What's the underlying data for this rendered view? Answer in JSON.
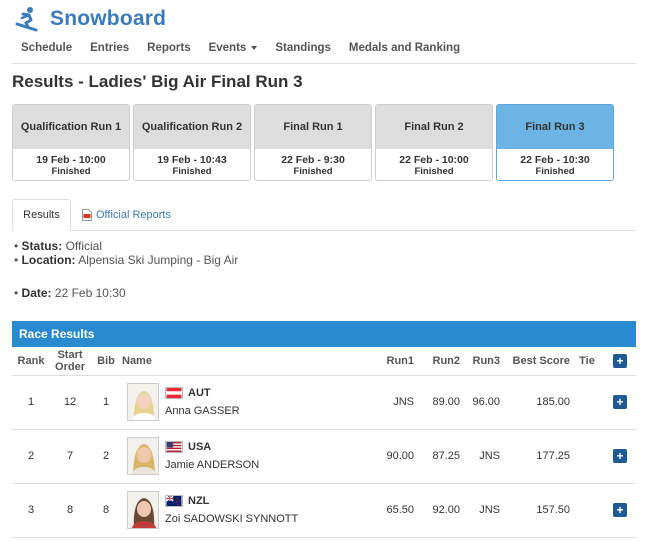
{
  "app": {
    "title": "Snowboard",
    "logo_icon": "snowboarder-icon"
  },
  "nav": [
    {
      "label": "Schedule"
    },
    {
      "label": "Entries"
    },
    {
      "label": "Reports"
    },
    {
      "label": "Events",
      "dropdown": true
    },
    {
      "label": "Standings"
    },
    {
      "label": "Medals and Ranking"
    }
  ],
  "page_title": "Results - Ladies' Big Air Final Run 3",
  "runs": [
    {
      "name": "Qualification Run 1",
      "date": "19 Feb - 10:00",
      "status": "Finished",
      "active": false
    },
    {
      "name": "Qualification Run 2",
      "date": "19 Feb - 10:43",
      "status": "Finished",
      "active": false
    },
    {
      "name": "Final Run 1",
      "date": "22 Feb - 9:30",
      "status": "Finished",
      "active": false
    },
    {
      "name": "Final Run 2",
      "date": "22 Feb - 10:00",
      "status": "Finished",
      "active": false
    },
    {
      "name": "Final Run 3",
      "date": "22 Feb - 10:30",
      "status": "Finished",
      "active": true
    }
  ],
  "tabs": {
    "results": "Results",
    "official_reports": "Official Reports"
  },
  "info": {
    "status_label": "Status:",
    "status_value": "Official",
    "location_label": "Location:",
    "location_value": "Alpensia Ski Jumping - Big Air",
    "date_label": "Date:",
    "date_value": "22 Feb 10:30"
  },
  "race_results": {
    "title": "Race Results",
    "headers": {
      "rank": "Rank",
      "start_order": "Start Order",
      "bib": "Bib",
      "name": "Name",
      "run1": "Run1",
      "run2": "Run2",
      "run3": "Run3",
      "best_score": "Best Score",
      "tie": "Tie",
      "expand": "+"
    },
    "rows": [
      {
        "rank": "1",
        "start_order": "12",
        "bib": "1",
        "country": "AUT",
        "name": "Anna GASSER",
        "run1": "JNS",
        "run2": "89.00",
        "run3": "96.00",
        "best_score": "185.00",
        "tie": "",
        "expand": "+"
      },
      {
        "rank": "2",
        "start_order": "7",
        "bib": "2",
        "country": "USA",
        "name": "Jamie ANDERSON",
        "run1": "90.00",
        "run2": "87.25",
        "run3": "JNS",
        "best_score": "177.25",
        "tie": "",
        "expand": "+"
      },
      {
        "rank": "3",
        "start_order": "8",
        "bib": "8",
        "country": "NZL",
        "name": "Zoi SADOWSKI SYNNOTT",
        "run1": "65.50",
        "run2": "92.00",
        "run3": "JNS",
        "best_score": "157.50",
        "tie": "",
        "expand": "+"
      }
    ]
  },
  "colors": {
    "brand": "#3a7bc0",
    "panel_header": "#2a8ad0",
    "active_run": "#6cb4e4",
    "plus_button": "#1e5a96"
  }
}
